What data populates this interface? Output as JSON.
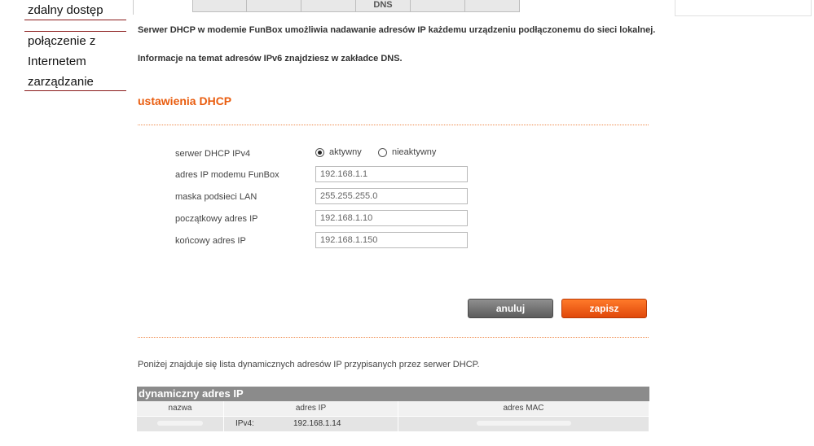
{
  "nav": {
    "items": [
      "zdalny dostęp",
      "połączenie z",
      "Internetem",
      "zarządzanie"
    ]
  },
  "tabs": [
    "",
    "",
    "",
    "DNS",
    "",
    ""
  ],
  "info": {
    "line1": "Serwer DHCP w modemie FunBox umożliwia nadawanie adresów IP każdemu urządzeniu podłączonemu do sieci lokalnej.",
    "line2": "Informacje na temat adresów IPv6 znajdziesz w zakładce DNS."
  },
  "section": {
    "title": "ustawienia DHCP"
  },
  "form": {
    "server_label": "serwer DHCP IPv4",
    "active_label": "aktywny",
    "inactive_label": "nieaktywny",
    "server_active": true,
    "modem_ip_label": "adres IP modemu FunBox",
    "modem_ip_value": "192.168.1.1",
    "mask_label": "maska podsieci LAN",
    "mask_value": "255.255.255.0",
    "start_ip_label": "początkowy adres IP",
    "start_ip_value": "192.168.1.10",
    "end_ip_label": "końcowy adres IP",
    "end_ip_value": "192.168.1.150"
  },
  "buttons": {
    "cancel": "anuluj",
    "save": "zapisz"
  },
  "list": {
    "note": "Poniżej znajduje się lista dynamicznych adresów IP przypisanych przez serwer DHCP.",
    "title": "dynamiczny adres IP",
    "columns": [
      "nazwa",
      "adres IP",
      "adres MAC"
    ],
    "rows": [
      {
        "ip_type": "IPv4:",
        "ip": "192.168.1.14"
      }
    ]
  },
  "colors": {
    "accent": "#e95d0f",
    "nav_rule": "#8a1a1a",
    "table_header": "#8b8b8b"
  }
}
